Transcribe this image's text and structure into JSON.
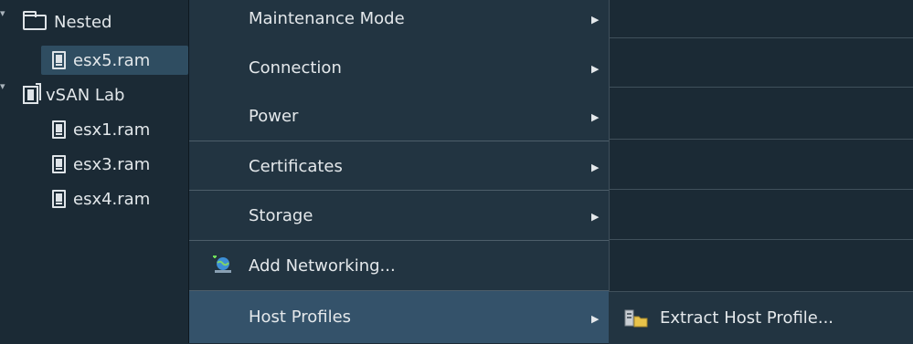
{
  "tree": {
    "items": [
      {
        "label": "Nested",
        "icon": "folder-icon"
      },
      {
        "label": "esx5.ram",
        "icon": "host-icon"
      },
      {
        "label": "vSAN Lab",
        "icon": "cluster-icon"
      },
      {
        "label": "esx1.ram",
        "icon": "host-icon"
      },
      {
        "label": "esx3.ram",
        "icon": "host-icon"
      },
      {
        "label": "esx4.ram",
        "icon": "host-icon"
      }
    ]
  },
  "menu": {
    "items": [
      {
        "label": "Maintenance Mode",
        "has_submenu": true
      },
      {
        "label": "Connection",
        "has_submenu": true
      },
      {
        "label": "Power",
        "has_submenu": true
      },
      {
        "label": "Certificates",
        "has_submenu": true
      },
      {
        "label": "Storage",
        "has_submenu": true
      },
      {
        "label": "Add Networking...",
        "icon": "add-networking-icon"
      },
      {
        "label": "Host Profiles",
        "has_submenu": true,
        "active": true
      }
    ],
    "submenu_arrow": "▶"
  },
  "submenu": {
    "items": [
      {
        "label": "Extract Host Profile...",
        "icon": "extract-host-profile-icon"
      }
    ]
  },
  "colors": {
    "background": "#1b2a35",
    "menu_bg": "#223441",
    "active_bg": "#34526a",
    "selected_tree_bg": "#2f4d61",
    "text": "#e4e8eb"
  }
}
